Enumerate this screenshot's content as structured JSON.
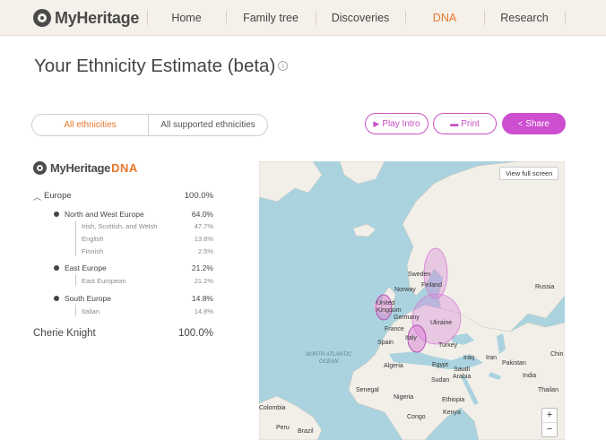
{
  "header": {
    "logo_text": "MyHeritage",
    "nav": [
      {
        "label": "Home"
      },
      {
        "label": "Family tree"
      },
      {
        "label": "Discoveries"
      },
      {
        "label": "DNA",
        "active": true
      },
      {
        "label": "Research"
      }
    ],
    "accent_color": "#e8762a"
  },
  "page": {
    "title": "Your Ethnicity Estimate (beta)",
    "info_icon": "i"
  },
  "tabs": {
    "selected": "All ethnicities",
    "other": "All supported ethnicities"
  },
  "actions": {
    "play_intro": "Play Intro",
    "print": "Print",
    "share": "Share",
    "brand_color": "#cd4fd0"
  },
  "results": {
    "logo_text": "MyHeritage",
    "logo_dna": "DNA",
    "europe": {
      "label": "Europe",
      "value": "100.0%"
    },
    "regions": [
      {
        "label": "North and West Europe",
        "value": "64.0%",
        "subs": [
          {
            "label": "Irish, Scottish, and Welsh",
            "value": "47.7%"
          },
          {
            "label": "English",
            "value": "13.8%"
          },
          {
            "label": "Finnish",
            "value": "2.5%"
          }
        ]
      },
      {
        "label": "East Europe",
        "value": "21.2%",
        "subs": [
          {
            "label": "East European",
            "value": "21.2%"
          }
        ]
      },
      {
        "label": "South Europe",
        "value": "14.8%",
        "subs": [
          {
            "label": "Italian",
            "value": "14.8%"
          }
        ]
      }
    ],
    "person": {
      "name": "Cherie Knight",
      "value": "100.0%"
    }
  },
  "map": {
    "view_full_screen": "View full screen",
    "zoom_in": "+",
    "zoom_out": "−",
    "labels": {
      "sweden": "Sweden",
      "finland": "Finland",
      "norway": "Norway",
      "russia": "Russia",
      "united_kingdom": "United\nKingdom",
      "germany": "Germany",
      "ukraine": "Ukraine",
      "france": "France",
      "italy": "Italy",
      "spain": "Spain",
      "turkey": "Turkey",
      "iraq": "Iraq",
      "iran": "Iran",
      "pakistan": "Pakistan",
      "chin": "Chin",
      "saudi_arabia": "Saudi\nArabia",
      "algeria": "Algeria",
      "egypt": "Egypt",
      "sudan": "Sudan",
      "india": "India",
      "senegal": "Senegal",
      "nigeria": "Nigeria",
      "ethiopia": "Ethiopia",
      "kenya": "Kenya",
      "congo": "Congo",
      "colombia": "Colombia",
      "peru": "Peru",
      "brazil": "Brazil",
      "thailand": "Thailan"
    },
    "ocean": "NORTH ATLANTIC\nOCEAN",
    "highlight_color": "#d77fd6"
  }
}
